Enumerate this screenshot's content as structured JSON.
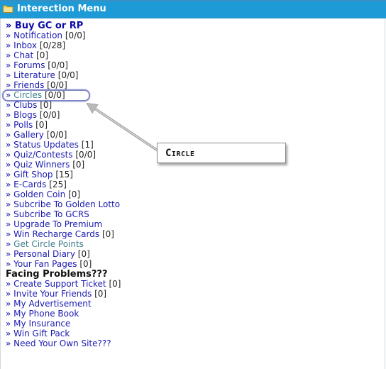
{
  "header": {
    "title": "Interection Menu"
  },
  "menu": {
    "buy_gc": "» Buy GC or RP",
    "items": [
      {
        "label": "Notification",
        "count": "[0/0]"
      },
      {
        "label": "Inbox",
        "count": "[0/28]"
      },
      {
        "label": "Chat",
        "count": "[0]"
      },
      {
        "label": "Forums",
        "count": "[0/0]"
      },
      {
        "label": "Literature",
        "count": "[0/0]"
      },
      {
        "label": "Friends",
        "count": "[0/0]"
      },
      {
        "label": "Circles",
        "count": "[0/0]"
      },
      {
        "label": "Clubs",
        "count": "[0]"
      },
      {
        "label": "Blogs",
        "count": "[0/0]"
      },
      {
        "label": "Polls",
        "count": "[0]"
      },
      {
        "label": "Gallery",
        "count": "[0/0]"
      },
      {
        "label": "Status Updates",
        "count": "[1]"
      },
      {
        "label": "Quiz/Contests",
        "count": "[0/0]"
      },
      {
        "label": "Quiz Winners",
        "count": "[0]"
      },
      {
        "label": "Gift Shop",
        "count": "[15]"
      },
      {
        "label": "E-Cards",
        "count": "[25]"
      },
      {
        "label": "Golden Coin",
        "count": "[0]"
      },
      {
        "label": "Subcribe To Golden Lotto",
        "count": ""
      },
      {
        "label": "Subcribe To GCRS",
        "count": ""
      },
      {
        "label": "Upgrade To Premium",
        "count": ""
      },
      {
        "label": "Win Recharge Cards",
        "count": "[0]"
      },
      {
        "label": "Get Circle Points",
        "count": ""
      },
      {
        "label": "Personal Diary",
        "count": "[0]"
      },
      {
        "label": "Your Fan Pages",
        "count": "[0]"
      }
    ],
    "problems_heading": "Facing Problems???",
    "support_items": [
      {
        "label": "Create Support Ticket",
        "count": "[0]"
      },
      {
        "label": "Invite Your Friends",
        "count": "[0]"
      },
      {
        "label": "My Advertisement",
        "count": ""
      },
      {
        "label": "My Phone Book",
        "count": ""
      },
      {
        "label": "My Insurance",
        "count": ""
      },
      {
        "label": "Win Gift Pack",
        "count": ""
      },
      {
        "label": "Need Your Own Site???",
        "count": ""
      }
    ]
  },
  "annotation": {
    "label": "Circle"
  },
  "icons": {
    "header_icon": "folder-icon",
    "bullet": "»"
  },
  "colors": {
    "header_bg": "#1e9bd7",
    "link": "#1a1ab0",
    "highlight": "#7f86c9"
  }
}
